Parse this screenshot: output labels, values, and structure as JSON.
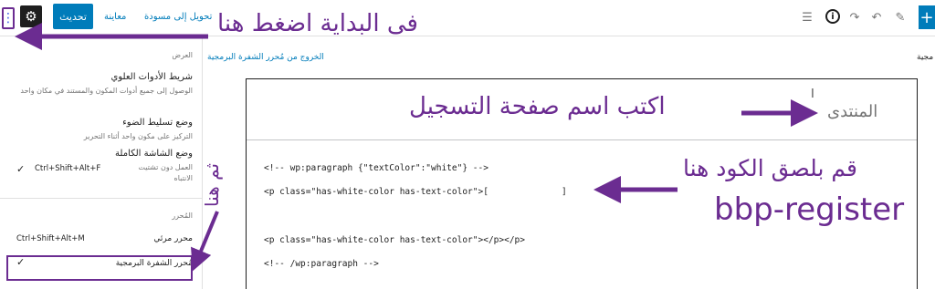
{
  "toolbar": {
    "update_label": "تحديث",
    "preview_label": "معاينة",
    "switch_draft_label": "تحويل إلى مسودة",
    "settings_icon": "gear-icon",
    "menu_icon": "more-vertical-icon",
    "info_icon": "info-icon",
    "add_icon": "plus-icon"
  },
  "sidebar": {
    "view_heading": "العرض",
    "items": [
      {
        "title": "شريط الأدوات العلوي",
        "desc": "الوصول إلى جميع أدوات المكون والمستند في مكان واحد"
      },
      {
        "title": "وضع تسليط الضوء",
        "desc": "التركيز على مكون واحد أثناء التحرير"
      },
      {
        "title": "وضع الشاشة الكاملة",
        "desc": "العمل دون تشتيت الانتباه",
        "shortcut": "Ctrl+Shift+Alt+F",
        "checked": "✓"
      }
    ],
    "editor_heading": "المُحرر",
    "visual_editor": {
      "label": "محرر مرئي",
      "shortcut": "Ctrl+Shift+Alt+M"
    },
    "code_editor": {
      "label": "مُحرر الشفرة البرمجية",
      "checked": "✓"
    }
  },
  "editor": {
    "breadcrumb_fragment": "مجية",
    "exit_code_editor": "الخروج من مُحرر الشفرة البرمجية",
    "page_title": "المنتدى",
    "code_lines": [
      "<!-- wp:paragraph {\"textColor\":\"white\"} -->",
      "<p class=\"has-white-color has-text-color\">[              ]",
      "<p class=\"has-white-color has-text-color\"></p></p>",
      "<!-- /wp:paragraph -->"
    ]
  },
  "annotations": {
    "first_click": "فى البداية اضغط هنا",
    "then_here": "ثم هنا",
    "write_title": "اكتب اسم صفحة التسجيل",
    "paste_code": "قم بلصق الكود هنا",
    "shortcode": "bbp-register"
  },
  "colors": {
    "accent": "#007cba",
    "annotation": "#6b2c91"
  }
}
